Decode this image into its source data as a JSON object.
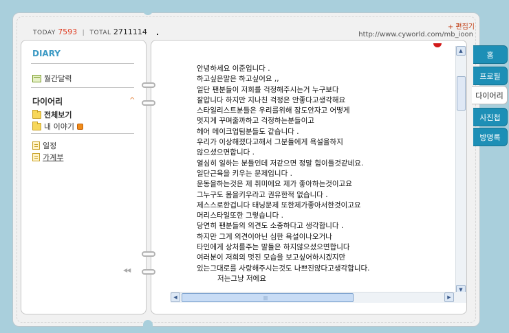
{
  "header": {
    "today_label": "TODAY",
    "today_count": "7593",
    "separator": "|",
    "total_label": "TOTAL",
    "total_count": "2711114",
    "edit_link": "+ 편집기",
    "url": "http://www.cyworld.com/mb_ioon"
  },
  "sidebar": {
    "title": "DIARY",
    "calendar": "월간달력",
    "section_title": "다이어리",
    "section_caret": "^",
    "items": [
      {
        "label": "전체보기"
      },
      {
        "label": "내 이야기"
      }
    ],
    "extra": [
      {
        "label": "일정"
      },
      {
        "label": "가계부"
      }
    ],
    "nav_arrows": "◀◀"
  },
  "post": {
    "lines": [
      "안녕하세요 이준입니다 .",
      "하고싶은말은 하고싶어요 ,,",
      "일단 팬분들이 저희를 걱정해주시는거 누구보다",
      "잘압니다 하지만 지나친 걱정은 안좋다고생각해요",
      "스타일리스트분들은 우리를위해 잠도안자고 어떻게",
      "멋지게 꾸며줄까하고 걱정하는분들이고",
      "헤어 메이크업팀분들도 같습니다 .",
      "우리가 이상해졌다고해서 그분들에게 욕설을하지",
      "않으셨으면합니다 .",
      "열심히 일하는 분들인데 저같으면 정말 힘이들것같네요.",
      "일단근육을 키우는 문제입니다 .",
      "운동을하는것은 제 취미에요 제가 좋아하는것이고요",
      "그누구도 몸을키우라고 권유한적 없습니다 .",
      "제스스로한겁니다 태닝문제 또한제가좋아서한것이고요",
      "머리스타일또한 그렇습니다 .",
      "당연히 팬분들의 의견도 소중하다고 생각합니다 .",
      "하지만 그게 의견이아닌 심한 욕설이나오거나",
      "타인에게 상처를주는 말들은 하지않으셨으면합니다",
      "여러분이 저희의 멋진 모습을 보고싶어하시겠지만",
      "있는그대로를 사랑해주시는것도 나쁘진않다고생각합니다.",
      "         저는그냥 저에요"
    ]
  },
  "tabs": [
    {
      "label": "홈",
      "active": false
    },
    {
      "label": "프로필",
      "active": false
    },
    {
      "label": "다이어리",
      "active": true
    },
    {
      "label": "사진첩",
      "active": false
    },
    {
      "label": "방명록",
      "active": false
    }
  ],
  "colors": {
    "background": "#a9cfdc",
    "accent_blue": "#3d9ac4",
    "tab_blue": "#1d8fb6",
    "today_red": "#e0371b"
  }
}
